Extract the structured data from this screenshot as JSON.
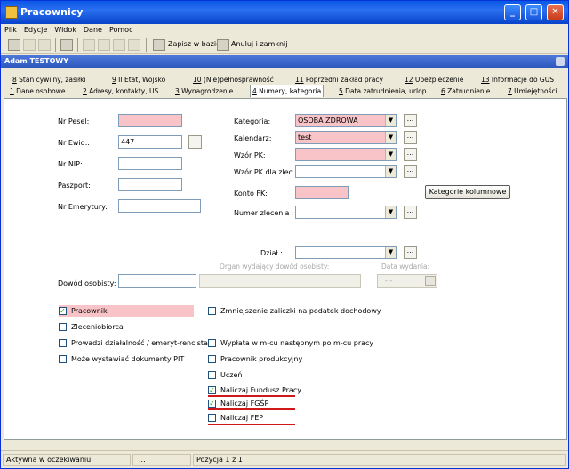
{
  "window": {
    "title": "Pracownicy",
    "controls": {
      "minimize": "_",
      "maximize": "□",
      "close": "✕"
    }
  },
  "menu": [
    "Plik",
    "Edycje",
    "Widok",
    "Dane",
    "Pomoc"
  ],
  "toolbar": {
    "save_label": "Zapisz w bazie",
    "cancel_label": "Anuluj i zamknij"
  },
  "user": {
    "name": "Adam TESTOWY"
  },
  "tabs_top": [
    {
      "num": "8",
      "label": " Stan cywilny, zasiłki"
    },
    {
      "num": "9",
      "label": " II Etat, Wojsko"
    },
    {
      "num": "10",
      "label": " (Nie)pełnosprawność"
    },
    {
      "num": "11",
      "label": " Poprzedni zakład pracy"
    },
    {
      "num": "12",
      "label": " Ubezpieczenie"
    },
    {
      "num": "13",
      "label": " Informacje do GUS"
    }
  ],
  "tabs_bottom": [
    {
      "num": "1",
      "label": " Dane osobowe"
    },
    {
      "num": "2",
      "label": " Adresy, kontakty, US"
    },
    {
      "num": "3",
      "label": " Wynagrodzenie"
    },
    {
      "num": "4",
      "label": " Numery, kategoria"
    },
    {
      "num": "5",
      "label": " Data zatrudnienia, urlop"
    },
    {
      "num": "6",
      "label": " Zatrudnienie"
    },
    {
      "num": "7",
      "label": " Umiejętności"
    }
  ],
  "form": {
    "pesel": {
      "label": "Nr Pesel:",
      "value": ""
    },
    "ewid": {
      "label": "Nr Ewid.:",
      "value": "447",
      "dots": "..."
    },
    "nip": {
      "label": "Nr NIP:",
      "value": ""
    },
    "paszport": {
      "label": "Paszport:",
      "value": ""
    },
    "emerytury": {
      "label": "Nr Emerytury:",
      "value": ""
    },
    "kategoria": {
      "label": "Kategoria:",
      "value": "OSOBA ZDROWA"
    },
    "kalendarz": {
      "label": "Kalendarz:",
      "value": "test"
    },
    "wzor_pk": {
      "label": "Wzór PK:",
      "value": ""
    },
    "wzor_pk_zlec": {
      "label": "Wzór PK dla zlec.:",
      "value": ""
    },
    "konto_fk": {
      "label": "Konto FK:",
      "value": ""
    },
    "numer_zlecenia": {
      "label": "Numer zlecenia :",
      "value": ""
    },
    "kategorie_button": "Kategorie kolumnowe",
    "dzial": {
      "label": "Dział :",
      "value": ""
    },
    "organ_label": "Organ wydający dowód osobisty:",
    "data_wydania_label": "Data wydania:",
    "data_wydania_value": "- -",
    "dowod": {
      "label": "Dowód osobisty:",
      "value": ""
    },
    "dots": "..."
  },
  "checkboxes_left": [
    {
      "label": "Pracownik",
      "checked": "✓"
    },
    {
      "label": "Zleceniobiorca",
      "checked": ""
    },
    {
      "label": "Prowadzi działalność / emeryt-rencista",
      "checked": ""
    },
    {
      "label": "Może wystawiać dokumenty PIT",
      "checked": ""
    }
  ],
  "checkboxes_right": [
    {
      "label": "Zmniejszenie zaliczki na podatek dochodowy",
      "checked": ""
    },
    {
      "label": "Wypłata w m-cu następnym po m-cu pracy",
      "checked": ""
    },
    {
      "label": "Pracownik produkcyjny",
      "checked": ""
    },
    {
      "label": "Uczeń",
      "checked": ""
    },
    {
      "label": "Naliczaj Fundusz Pracy",
      "checked": "✓"
    },
    {
      "label": "Naliczaj FGŚP",
      "checked": "✓"
    },
    {
      "label": "Naliczaj FEP",
      "checked": ""
    }
  ],
  "status": {
    "left": "Aktywna w oczekiwaniu",
    "middle": "...",
    "right": "Pozycja 1 z 1"
  },
  "colors": {
    "required": "#f8c4c8",
    "title": "#0a58e6",
    "underline": "#d01818"
  }
}
